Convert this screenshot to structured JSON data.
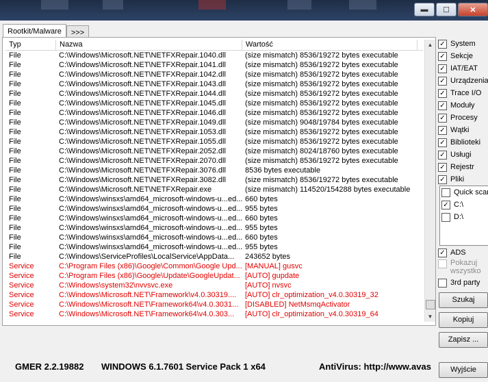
{
  "window": {
    "minimize": "▬",
    "maximize": "☐",
    "close": "✕"
  },
  "tabs": [
    {
      "label": "Rootkit/Malware"
    },
    {
      "label": ">>>"
    }
  ],
  "table": {
    "headers": [
      "Typ",
      "Nazwa",
      "Wartość"
    ],
    "rows": [
      [
        "File",
        "C:\\Windows\\Microsoft.NET\\NETFXRepair.1040.dll",
        "(size mismatch) 8536/19272 bytes executable"
      ],
      [
        "File",
        "C:\\Windows\\Microsoft.NET\\NETFXRepair.1041.dll",
        "(size mismatch) 8536/19272 bytes executable"
      ],
      [
        "File",
        "C:\\Windows\\Microsoft.NET\\NETFXRepair.1042.dll",
        "(size mismatch) 8536/19272 bytes executable"
      ],
      [
        "File",
        "C:\\Windows\\Microsoft.NET\\NETFXRepair.1043.dll",
        "(size mismatch) 8536/19272 bytes executable"
      ],
      [
        "File",
        "C:\\Windows\\Microsoft.NET\\NETFXRepair.1044.dll",
        "(size mismatch) 8536/19272 bytes executable"
      ],
      [
        "File",
        "C:\\Windows\\Microsoft.NET\\NETFXRepair.1045.dll",
        "(size mismatch) 8536/19272 bytes executable"
      ],
      [
        "File",
        "C:\\Windows\\Microsoft.NET\\NETFXRepair.1046.dll",
        "(size mismatch) 8536/19272 bytes executable"
      ],
      [
        "File",
        "C:\\Windows\\Microsoft.NET\\NETFXRepair.1049.dll",
        "(size mismatch) 9048/19784 bytes executable"
      ],
      [
        "File",
        "C:\\Windows\\Microsoft.NET\\NETFXRepair.1053.dll",
        "(size mismatch) 8536/19272 bytes executable"
      ],
      [
        "File",
        "C:\\Windows\\Microsoft.NET\\NETFXRepair.1055.dll",
        "(size mismatch) 8536/19272 bytes executable"
      ],
      [
        "File",
        "C:\\Windows\\Microsoft.NET\\NETFXRepair.2052.dll",
        "(size mismatch) 8024/18760 bytes executable"
      ],
      [
        "File",
        "C:\\Windows\\Microsoft.NET\\NETFXRepair.2070.dll",
        "(size mismatch) 8536/19272 bytes executable"
      ],
      [
        "File",
        "C:\\Windows\\Microsoft.NET\\NETFXRepair.3076.dll",
        "8536 bytes executable"
      ],
      [
        "File",
        "C:\\Windows\\Microsoft.NET\\NETFXRepair.3082.dll",
        "(size mismatch) 8536/19272 bytes executable"
      ],
      [
        "File",
        "C:\\Windows\\Microsoft.NET\\NETFXRepair.exe",
        "(size mismatch) 114520/154288 bytes executable"
      ],
      [
        "File",
        "C:\\Windows\\winsxs\\amd64_microsoft-windows-u...ed...",
        "660 bytes"
      ],
      [
        "File",
        "C:\\Windows\\winsxs\\amd64_microsoft-windows-u...ed...",
        "955 bytes"
      ],
      [
        "File",
        "C:\\Windows\\winsxs\\amd64_microsoft-windows-u...ed...",
        "660 bytes"
      ],
      [
        "File",
        "C:\\Windows\\winsxs\\amd64_microsoft-windows-u...ed...",
        "955 bytes"
      ],
      [
        "File",
        "C:\\Windows\\winsxs\\amd64_microsoft-windows-u...ed...",
        "660 bytes"
      ],
      [
        "File",
        "C:\\Windows\\winsxs\\amd64_microsoft-windows-u...ed...",
        "955 bytes"
      ],
      [
        "File",
        "C:\\Windows\\ServiceProfiles\\LocalService\\AppData...",
        "243652 bytes"
      ],
      [
        "Service",
        "C:\\Program Files (x86)\\Google\\Common\\Google Upd...",
        "[MANUAL] gusvc"
      ],
      [
        "Service",
        "C:\\Program Files (x86)\\Google\\Update\\GoogleUpdat...",
        "[AUTO] gupdate"
      ],
      [
        "Service",
        "C:\\Windows\\system32\\nvvsvc.exe",
        "[AUTO] nvsvc"
      ],
      [
        "Service",
        "C:\\Windows\\Microsoft.NET\\Framework\\v4.0.30319....",
        "[AUTO] clr_optimization_v4.0.30319_32"
      ],
      [
        "Service",
        "C:\\Windows\\Microsoft.NET\\Framework64\\v4.0.3031...",
        "[DISABLED] NetMsmqActivator"
      ],
      [
        "Service",
        "C:\\Windows\\Microsoft.NET\\Framework64\\v4.0.303...",
        "[AUTO] clr_optimization_v4.0.30319_64"
      ]
    ]
  },
  "options": [
    {
      "label": "System",
      "checked": true
    },
    {
      "label": "Sekcje",
      "checked": true
    },
    {
      "label": "IAT/EAT",
      "checked": true
    },
    {
      "label": "Urządzenia",
      "checked": true
    },
    {
      "label": "Trace I/O",
      "checked": true
    },
    {
      "label": "Moduły",
      "checked": true
    },
    {
      "label": "Procesy",
      "checked": true
    },
    {
      "label": "Wątki",
      "checked": true
    },
    {
      "label": "Biblioteki",
      "checked": true
    },
    {
      "label": "Usługi",
      "checked": true
    },
    {
      "label": "Rejestr",
      "checked": true
    },
    {
      "label": "Pliki",
      "checked": true
    }
  ],
  "drives": [
    {
      "label": "Quick scan",
      "checked": false
    },
    {
      "label": "C:\\",
      "checked": true
    },
    {
      "label": "D:\\",
      "checked": false
    }
  ],
  "extra": {
    "ads": {
      "label": "ADS",
      "checked": true
    },
    "show_all": "Pokazuj wszystko",
    "third_party": "3rd party"
  },
  "buttons": {
    "scan": "Szukaj",
    "copy": "Kopiuj",
    "save": "Zapisz ...",
    "exit": "Wyjście"
  },
  "status": {
    "version": "GMER 2.2.19882",
    "os": "WINDOWS 6.1.7601 Service Pack 1 x64",
    "antivirus": "AntiVirus: http://www.avas"
  }
}
